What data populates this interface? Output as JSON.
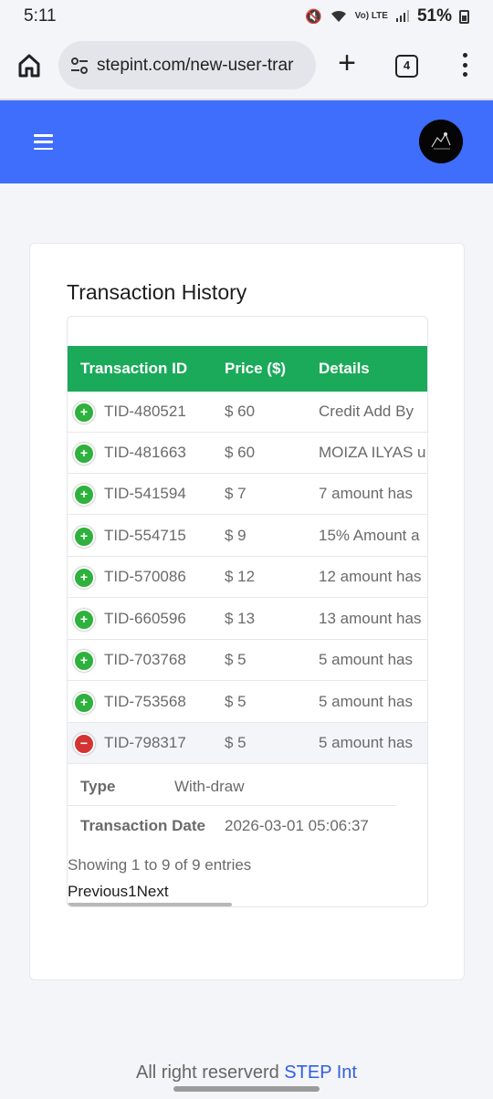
{
  "status_bar": {
    "time": "5:11",
    "battery": "51%",
    "network": "Vo) LTE"
  },
  "browser": {
    "url": "stepint.com/new-user-trar",
    "tab_count": "4"
  },
  "page": {
    "title": "Transaction History",
    "table": {
      "headers": [
        "Transaction ID",
        "Price ($)",
        "Details"
      ],
      "rows": [
        {
          "id": "TID-480521",
          "price": "$ 60",
          "details": "Credit Add By"
        },
        {
          "id": "TID-481663",
          "price": "$ 60",
          "details": "MOIZA ILYAS u"
        },
        {
          "id": "TID-541594",
          "price": "$ 7",
          "details": "7 amount has"
        },
        {
          "id": "TID-554715",
          "price": "$ 9",
          "details": "15% Amount a"
        },
        {
          "id": "TID-570086",
          "price": "$ 12",
          "details": "12 amount has"
        },
        {
          "id": "TID-660596",
          "price": "$ 13",
          "details": "13 amount has"
        },
        {
          "id": "TID-703768",
          "price": "$ 5",
          "details": "5 amount has"
        },
        {
          "id": "TID-753568",
          "price": "$ 5",
          "details": "5 amount has"
        },
        {
          "id": "TID-798317",
          "price": "$ 5",
          "details": "5 amount has"
        }
      ],
      "expanded_row": {
        "type_label": "Type",
        "type_value": "With-draw",
        "date_label": "Transaction Date",
        "date_value": "2026-03-01 05:06:37"
      }
    },
    "entries_info": "Showing 1 to 9 of 9 entries",
    "pagination": {
      "previous": "Previous",
      "current": "1",
      "next": "Next"
    }
  },
  "footer": {
    "text": "All right reserverd ",
    "brand": "STEP Int"
  },
  "colors": {
    "header_blue": "#3f6dfc",
    "table_green": "#1aaa59",
    "plus_green": "#2fb13d",
    "minus_red": "#d33333"
  }
}
